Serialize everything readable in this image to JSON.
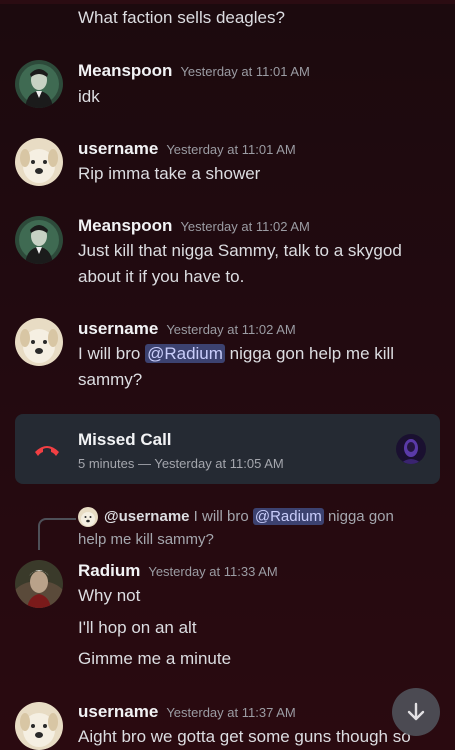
{
  "continued_message": "What faction sells deagles?",
  "messages": [
    {
      "author": "Meanspoon",
      "timestamp": "Yesterday at 11:01 AM",
      "lines": [
        "idk"
      ]
    },
    {
      "author": "username",
      "timestamp": "Yesterday at 11:01 AM",
      "lines": [
        "Rip imma take a shower"
      ]
    },
    {
      "author": "Meanspoon",
      "timestamp": "Yesterday at 11:02 AM",
      "lines": [
        "Just kill that nigga Sammy, talk to a skygod",
        "about it if you have to."
      ]
    },
    {
      "author": "username",
      "timestamp": "Yesterday at 11:02 AM",
      "text_before": "I will bro ",
      "mention": "@Radium",
      "text_after": " nigga gon help me kill",
      "line2": "sammy?"
    },
    {
      "author": "Radium",
      "timestamp": "Yesterday at 11:33 AM",
      "lines": [
        "Why not",
        "I'll hop on an alt",
        "Gimme me a minute"
      ]
    },
    {
      "author": "username",
      "timestamp": "Yesterday at 11:37 AM",
      "lines": [
        "Aight bro we gotta get some guns though so"
      ]
    }
  ],
  "missed_call": {
    "title": "Missed Call",
    "subtitle": "5 minutes — Yesterday at 11:05 AM"
  },
  "reply_preview": {
    "user": "@username",
    "text_before": " I will bro ",
    "mention": "@Radium",
    "text_after": " nigga gon",
    "line2": "help me kill sammy?"
  },
  "icons": {
    "scroll_down": "arrow-down-icon",
    "missed_call": "phone-hangup-icon"
  },
  "colors": {
    "missed_call_red": "#f23f43",
    "mention_bg": "#3c4270",
    "mention_text": "#c9cdfb"
  }
}
